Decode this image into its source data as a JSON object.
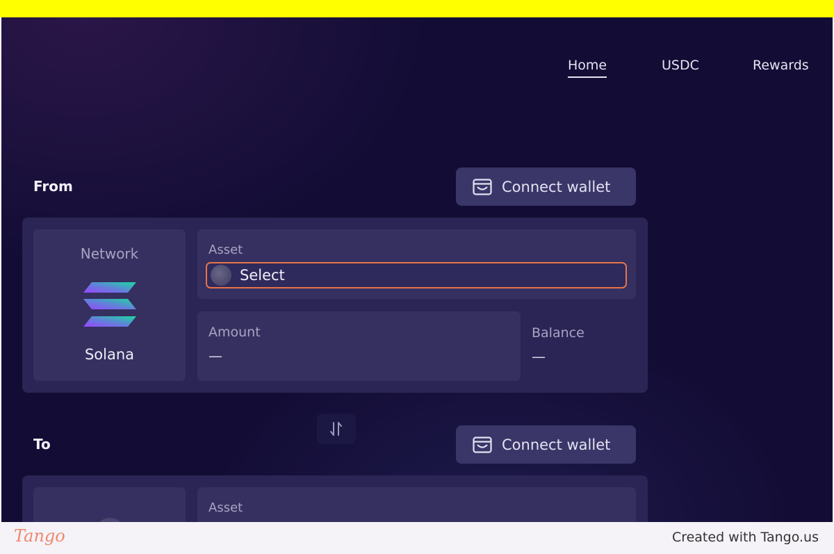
{
  "nav": {
    "items": [
      "Home",
      "USDC",
      "Rewards"
    ],
    "active": "Home"
  },
  "from": {
    "title": "From",
    "connect_label": "Connect wallet",
    "network_label": "Network",
    "network_name": "Solana",
    "asset_label": "Asset",
    "asset_value": "Select",
    "amount_label": "Amount",
    "amount_value": "—",
    "balance_label": "Balance",
    "balance_value": "—"
  },
  "swap_icon": "swap-arrows-icon",
  "to": {
    "title": "To",
    "connect_label": "Connect wallet",
    "asset_label": "Asset"
  },
  "footer": {
    "logo_text": "Tango",
    "credit": "Created with Tango.us"
  },
  "colors": {
    "highlight": "#e8744a",
    "background": "#130d36",
    "topbar": "#ffff00"
  }
}
